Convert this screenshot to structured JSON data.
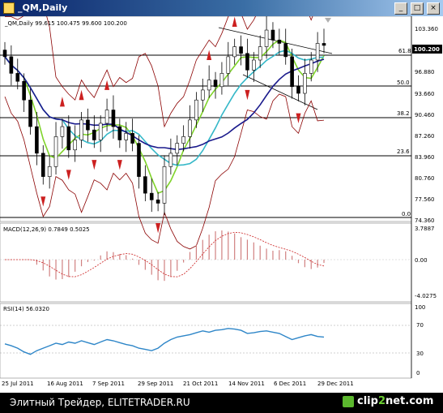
{
  "window": {
    "title": "_QM,Daily",
    "controls": {
      "minimize": "_",
      "maximize": "□",
      "close": "×"
    }
  },
  "symbol_info": "_QM,Daily  99.615 100.475 99.600 100.200",
  "current_price": "100.200",
  "price_axis": {
    "ticks": [
      "103.360",
      "100.200",
      "96.880",
      "93.660",
      "90.460",
      "87.260",
      "83.960",
      "80.760",
      "77.560",
      "74.360"
    ]
  },
  "fibonacci": {
    "levels": [
      "61.8",
      "50.0",
      "38.2",
      "23.6",
      "0.0"
    ]
  },
  "macd": {
    "label": "MACD(12,26,9) 0.7849 0.5025",
    "ticks": [
      "3.7887",
      "0.00",
      "-4.0275"
    ]
  },
  "rsi": {
    "label": "RSI(14) 56.0320",
    "ticks": [
      "100",
      "70",
      "30",
      "0"
    ]
  },
  "date_axis": {
    "labels": [
      "25 Jul 2011",
      "16 Aug 2011",
      "7 Sep 2011",
      "29 Sep 2011",
      "21 Oct 2011",
      "14 Nov 2011",
      "6 Dec 2011",
      "29 Dec 2011"
    ]
  },
  "footer": {
    "source": "Элитный Трейдер, ELITETRADER.RU",
    "brand_a": "clip",
    "brand_b": "2",
    "brand_c": "net",
    "brand_d": ".com"
  },
  "colors": {
    "candles": "#000000",
    "bollinger": "#8b0000",
    "ma_fast": "#7fd32a",
    "ma_mid": "#35b8c8",
    "ma_slow": "#1a1a8c",
    "fractals": "#cc2020",
    "macd_hist": "#d08080",
    "macd_signal": "#cc2020",
    "rsi_line": "#2e86c8"
  },
  "chart_data": {
    "type": "candlestick",
    "title": "_QM,Daily",
    "ylim": [
      74.36,
      103.36
    ],
    "x": [
      "25 Jul 2011",
      "16 Aug 2011",
      "7 Sep 2011",
      "29 Sep 2011",
      "21 Oct 2011",
      "14 Nov 2011",
      "6 Dec 2011",
      "29 Dec 2011"
    ],
    "close_path": [
      98.5,
      96.0,
      94.8,
      92.0,
      88.0,
      84.0,
      80.5,
      82.0,
      86.5,
      88.0,
      84.5,
      86.0,
      89.0,
      87.5,
      86.0,
      88.5,
      90.5,
      88.0,
      86.0,
      87.0,
      85.5,
      80.5,
      78.0,
      77.0,
      76.5,
      82.0,
      84.0,
      85.5,
      86.5,
      89.0,
      92.0,
      93.5,
      95.0,
      94.0,
      96.0,
      98.5,
      100.0,
      99.0,
      96.5,
      98.0,
      100.0,
      102.5,
      101.0,
      100.5,
      98.5,
      94.0,
      93.0,
      96.0,
      98.0,
      100.5,
      100.2
    ],
    "rsi_path": [
      45,
      42,
      38,
      32,
      28,
      34,
      38,
      42,
      46,
      44,
      48,
      46,
      50,
      47,
      44,
      48,
      52,
      50,
      47,
      44,
      42,
      38,
      36,
      34,
      38,
      46,
      52,
      56,
      58,
      60,
      63,
      66,
      64,
      67,
      68,
      70,
      69,
      67,
      62,
      63,
      65,
      66,
      64,
      62,
      57,
      52,
      55,
      58,
      60,
      57,
      56
    ]
  }
}
